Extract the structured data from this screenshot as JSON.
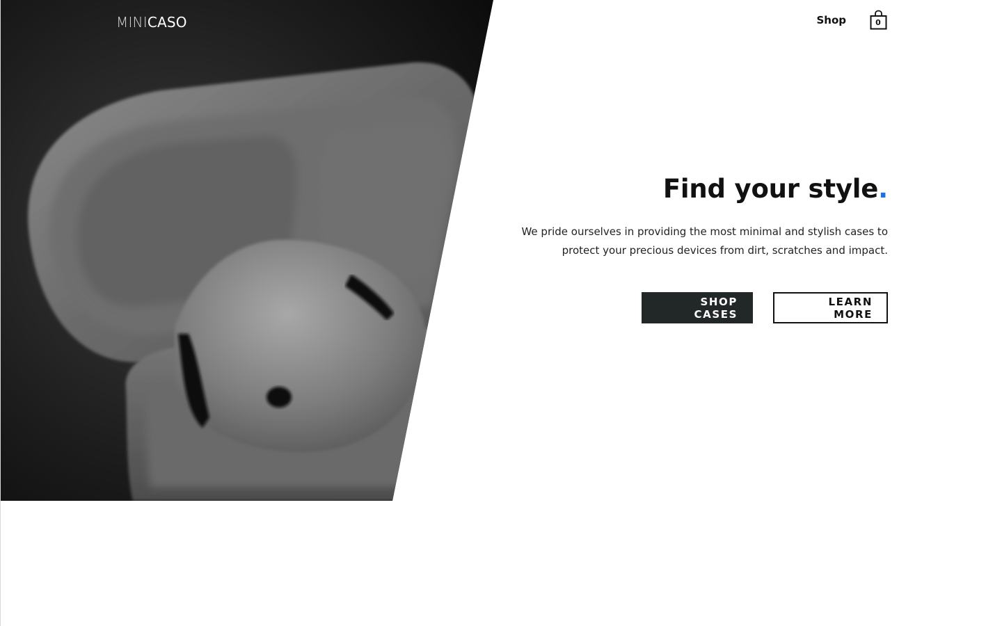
{
  "header": {
    "logo_light": "MINI",
    "logo_strong": "CASO",
    "nav_shop": "Shop",
    "cart_count": "0"
  },
  "hero": {
    "headline_text": "Find your style",
    "headline_dot": ".",
    "tagline_line1": "We pride ourselves in providing the most minimal and stylish cases to",
    "tagline_line2": "protect your precious devices from dirt, scratches and impact.",
    "primary_button": "SHOP CASES",
    "secondary_button": "LEARN MORE"
  },
  "colors": {
    "accent": "#1e6fe8",
    "primary_button_bg": "#222828",
    "text": "#111111"
  },
  "icons": {
    "cart": "shopping-bag-icon"
  }
}
